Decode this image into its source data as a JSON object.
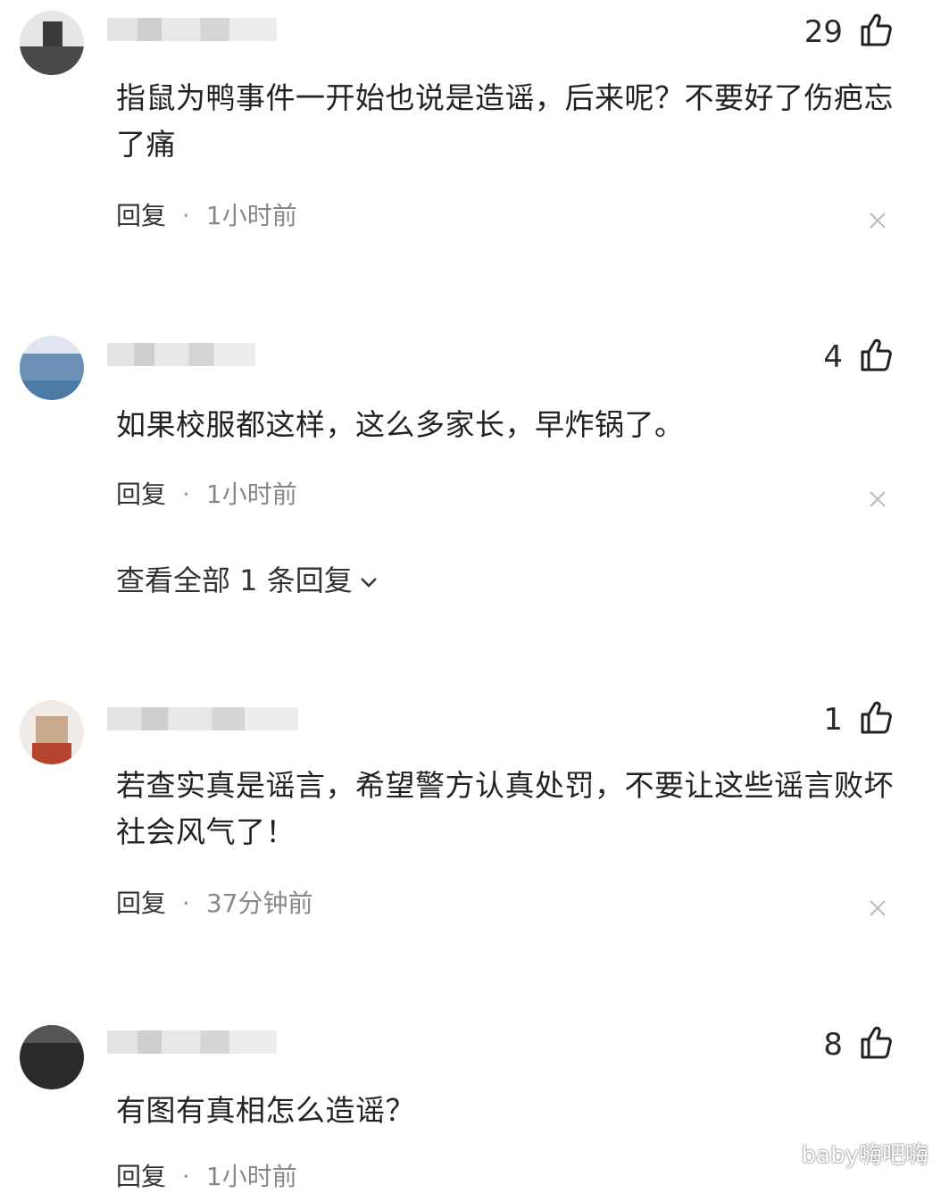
{
  "comments": [
    {
      "likes": "29",
      "text": "指鼠为鸭事件一开始也说是造谣，后来呢？不要好了伤疤忘了痛",
      "reply": "回复",
      "dot": "·",
      "time": "1小时前"
    },
    {
      "likes": "4",
      "text": "如果校服都这样，这么多家长，早炸锅了。",
      "reply": "回复",
      "dot": "·",
      "time": "1小时前",
      "view_replies": "查看全部 1 条回复"
    },
    {
      "likes": "1",
      "text": "若查实真是谣言，希望警方认真处罚，不要让这些谣言败坏社会风气了！",
      "reply": "回复",
      "dot": "·",
      "time": "37分钟前"
    },
    {
      "likes": "8",
      "text": "有图有真相怎么造谣？",
      "reply": "回复",
      "dot": "·",
      "time": "1小时前"
    }
  ],
  "watermark": "baby嗨吧嗨",
  "icons": {
    "like": "thumbs-up-icon",
    "close": "close-icon",
    "chevron": "chevron-down-icon"
  }
}
